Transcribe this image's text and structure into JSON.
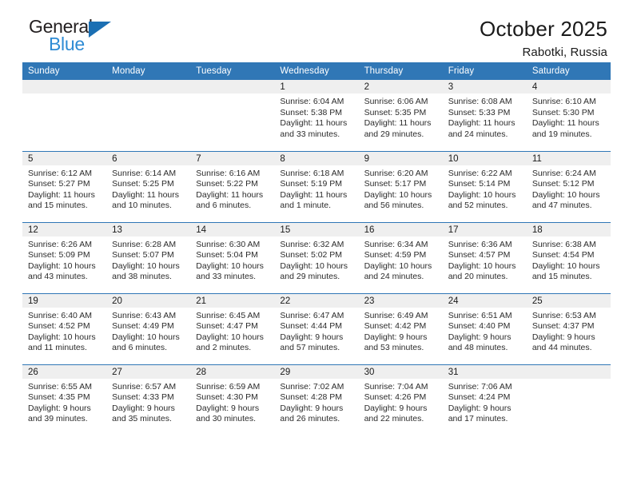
{
  "logo": {
    "primary_text": "General",
    "secondary_text": "Blue",
    "triangle_color": "#1b6fb3",
    "secondary_color": "#2e8bd4"
  },
  "header": {
    "title": "October 2025",
    "subtitle": "Rabotki, Russia"
  },
  "theme": {
    "header_bar_color": "#3077b6",
    "daynum_band_color": "#efefef",
    "cell_background": "#ffffff",
    "text_color": "#2b2b2b"
  },
  "weekday_headers": [
    "Sunday",
    "Monday",
    "Tuesday",
    "Wednesday",
    "Thursday",
    "Friday",
    "Saturday"
  ],
  "weeks": [
    [
      {
        "day": "",
        "empty": true
      },
      {
        "day": "",
        "empty": true
      },
      {
        "day": "",
        "empty": true
      },
      {
        "day": "1",
        "sunrise": "Sunrise: 6:04 AM",
        "sunset": "Sunset: 5:38 PM",
        "daylight_line1": "Daylight: 11 hours",
        "daylight_line2": "and 33 minutes."
      },
      {
        "day": "2",
        "sunrise": "Sunrise: 6:06 AM",
        "sunset": "Sunset: 5:35 PM",
        "daylight_line1": "Daylight: 11 hours",
        "daylight_line2": "and 29 minutes."
      },
      {
        "day": "3",
        "sunrise": "Sunrise: 6:08 AM",
        "sunset": "Sunset: 5:33 PM",
        "daylight_line1": "Daylight: 11 hours",
        "daylight_line2": "and 24 minutes."
      },
      {
        "day": "4",
        "sunrise": "Sunrise: 6:10 AM",
        "sunset": "Sunset: 5:30 PM",
        "daylight_line1": "Daylight: 11 hours",
        "daylight_line2": "and 19 minutes."
      }
    ],
    [
      {
        "day": "5",
        "sunrise": "Sunrise: 6:12 AM",
        "sunset": "Sunset: 5:27 PM",
        "daylight_line1": "Daylight: 11 hours",
        "daylight_line2": "and 15 minutes."
      },
      {
        "day": "6",
        "sunrise": "Sunrise: 6:14 AM",
        "sunset": "Sunset: 5:25 PM",
        "daylight_line1": "Daylight: 11 hours",
        "daylight_line2": "and 10 minutes."
      },
      {
        "day": "7",
        "sunrise": "Sunrise: 6:16 AM",
        "sunset": "Sunset: 5:22 PM",
        "daylight_line1": "Daylight: 11 hours",
        "daylight_line2": "and 6 minutes."
      },
      {
        "day": "8",
        "sunrise": "Sunrise: 6:18 AM",
        "sunset": "Sunset: 5:19 PM",
        "daylight_line1": "Daylight: 11 hours",
        "daylight_line2": "and 1 minute."
      },
      {
        "day": "9",
        "sunrise": "Sunrise: 6:20 AM",
        "sunset": "Sunset: 5:17 PM",
        "daylight_line1": "Daylight: 10 hours",
        "daylight_line2": "and 56 minutes."
      },
      {
        "day": "10",
        "sunrise": "Sunrise: 6:22 AM",
        "sunset": "Sunset: 5:14 PM",
        "daylight_line1": "Daylight: 10 hours",
        "daylight_line2": "and 52 minutes."
      },
      {
        "day": "11",
        "sunrise": "Sunrise: 6:24 AM",
        "sunset": "Sunset: 5:12 PM",
        "daylight_line1": "Daylight: 10 hours",
        "daylight_line2": "and 47 minutes."
      }
    ],
    [
      {
        "day": "12",
        "sunrise": "Sunrise: 6:26 AM",
        "sunset": "Sunset: 5:09 PM",
        "daylight_line1": "Daylight: 10 hours",
        "daylight_line2": "and 43 minutes."
      },
      {
        "day": "13",
        "sunrise": "Sunrise: 6:28 AM",
        "sunset": "Sunset: 5:07 PM",
        "daylight_line1": "Daylight: 10 hours",
        "daylight_line2": "and 38 minutes."
      },
      {
        "day": "14",
        "sunrise": "Sunrise: 6:30 AM",
        "sunset": "Sunset: 5:04 PM",
        "daylight_line1": "Daylight: 10 hours",
        "daylight_line2": "and 33 minutes."
      },
      {
        "day": "15",
        "sunrise": "Sunrise: 6:32 AM",
        "sunset": "Sunset: 5:02 PM",
        "daylight_line1": "Daylight: 10 hours",
        "daylight_line2": "and 29 minutes."
      },
      {
        "day": "16",
        "sunrise": "Sunrise: 6:34 AM",
        "sunset": "Sunset: 4:59 PM",
        "daylight_line1": "Daylight: 10 hours",
        "daylight_line2": "and 24 minutes."
      },
      {
        "day": "17",
        "sunrise": "Sunrise: 6:36 AM",
        "sunset": "Sunset: 4:57 PM",
        "daylight_line1": "Daylight: 10 hours",
        "daylight_line2": "and 20 minutes."
      },
      {
        "day": "18",
        "sunrise": "Sunrise: 6:38 AM",
        "sunset": "Sunset: 4:54 PM",
        "daylight_line1": "Daylight: 10 hours",
        "daylight_line2": "and 15 minutes."
      }
    ],
    [
      {
        "day": "19",
        "sunrise": "Sunrise: 6:40 AM",
        "sunset": "Sunset: 4:52 PM",
        "daylight_line1": "Daylight: 10 hours",
        "daylight_line2": "and 11 minutes."
      },
      {
        "day": "20",
        "sunrise": "Sunrise: 6:43 AM",
        "sunset": "Sunset: 4:49 PM",
        "daylight_line1": "Daylight: 10 hours",
        "daylight_line2": "and 6 minutes."
      },
      {
        "day": "21",
        "sunrise": "Sunrise: 6:45 AM",
        "sunset": "Sunset: 4:47 PM",
        "daylight_line1": "Daylight: 10 hours",
        "daylight_line2": "and 2 minutes."
      },
      {
        "day": "22",
        "sunrise": "Sunrise: 6:47 AM",
        "sunset": "Sunset: 4:44 PM",
        "daylight_line1": "Daylight: 9 hours",
        "daylight_line2": "and 57 minutes."
      },
      {
        "day": "23",
        "sunrise": "Sunrise: 6:49 AM",
        "sunset": "Sunset: 4:42 PM",
        "daylight_line1": "Daylight: 9 hours",
        "daylight_line2": "and 53 minutes."
      },
      {
        "day": "24",
        "sunrise": "Sunrise: 6:51 AM",
        "sunset": "Sunset: 4:40 PM",
        "daylight_line1": "Daylight: 9 hours",
        "daylight_line2": "and 48 minutes."
      },
      {
        "day": "25",
        "sunrise": "Sunrise: 6:53 AM",
        "sunset": "Sunset: 4:37 PM",
        "daylight_line1": "Daylight: 9 hours",
        "daylight_line2": "and 44 minutes."
      }
    ],
    [
      {
        "day": "26",
        "sunrise": "Sunrise: 6:55 AM",
        "sunset": "Sunset: 4:35 PM",
        "daylight_line1": "Daylight: 9 hours",
        "daylight_line2": "and 39 minutes."
      },
      {
        "day": "27",
        "sunrise": "Sunrise: 6:57 AM",
        "sunset": "Sunset: 4:33 PM",
        "daylight_line1": "Daylight: 9 hours",
        "daylight_line2": "and 35 minutes."
      },
      {
        "day": "28",
        "sunrise": "Sunrise: 6:59 AM",
        "sunset": "Sunset: 4:30 PM",
        "daylight_line1": "Daylight: 9 hours",
        "daylight_line2": "and 30 minutes."
      },
      {
        "day": "29",
        "sunrise": "Sunrise: 7:02 AM",
        "sunset": "Sunset: 4:28 PM",
        "daylight_line1": "Daylight: 9 hours",
        "daylight_line2": "and 26 minutes."
      },
      {
        "day": "30",
        "sunrise": "Sunrise: 7:04 AM",
        "sunset": "Sunset: 4:26 PM",
        "daylight_line1": "Daylight: 9 hours",
        "daylight_line2": "and 22 minutes."
      },
      {
        "day": "31",
        "sunrise": "Sunrise: 7:06 AM",
        "sunset": "Sunset: 4:24 PM",
        "daylight_line1": "Daylight: 9 hours",
        "daylight_line2": "and 17 minutes."
      },
      {
        "day": "",
        "empty": true
      }
    ]
  ]
}
